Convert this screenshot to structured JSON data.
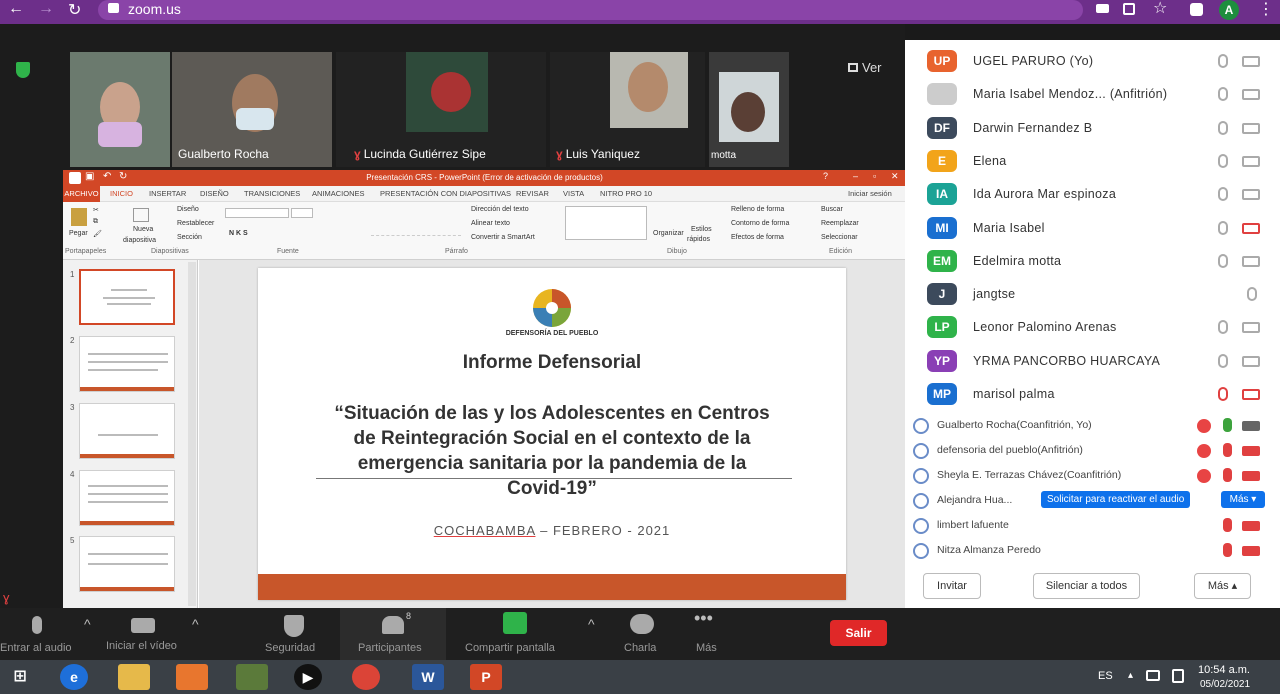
{
  "browser": {
    "url": "zoom.us",
    "avatar": "A",
    "back_icon": "←",
    "forward_icon": "→",
    "reload_icon": "↻"
  },
  "videos": [
    {
      "name": ""
    },
    {
      "name": "Gualberto Rocha"
    },
    {
      "name": "Lucinda Gutiérrez Sipe"
    },
    {
      "name": "Luis Yaniquez"
    },
    {
      "name": "motta"
    }
  ],
  "view_label": "Ver",
  "ppt": {
    "title": "Presentación CRS - PowerPoint (Error de activación de productos)",
    "tabs": [
      "ARCHIVO",
      "INICIO",
      "INSERTAR",
      "DISEÑO",
      "TRANSICIONES",
      "ANIMACIONES",
      "PRESENTACIÓN CON DIAPOSITIVAS",
      "REVISAR",
      "VISTA",
      "NITRO PRO 10"
    ],
    "signin": "Iniciar sesión",
    "groups": [
      "Portapapeles",
      "Diapositivas",
      "Fuente",
      "Párrafo",
      "Dibujo",
      "Edición"
    ],
    "ribbon": {
      "pegar": "Pegar",
      "nueva": "Nueva",
      "diapositiva": "diapositiva",
      "diseno": "Diseño",
      "restablecer": "Restablecer",
      "seccion": "Sección",
      "direccion": "Dirección del texto",
      "alinear": "Alinear texto",
      "convertir": "Convertir a SmartArt",
      "organizar": "Organizar",
      "estilos": "Estilos",
      "rapidos": "rápidos",
      "relleno": "Relleno de forma",
      "contorno": "Contorno de forma",
      "efectos": "Efectos de forma",
      "buscar": "Buscar",
      "reemplazar": "Reemplazar",
      "seleccionar": "Seleccionar"
    },
    "thumb_numbers": [
      "1",
      "2",
      "3",
      "4",
      "5"
    ],
    "slide": {
      "logo_text": "DEFENSORÍA DEL PUEBLO",
      "heading": "Informe Defensorial",
      "quote": "“Situación de las y los Adolescentes en Centros de Reintegración Social en el contexto de la emergencia sanitaria por la pandemia de la Covid-19”",
      "place_city": "COCHABAMBA",
      "place_rest": " – FEBRERO - 2021"
    }
  },
  "participants": [
    {
      "initials": "UP",
      "name": "UGEL PARURO (Yo)",
      "color": "#e8632e",
      "mic": "on",
      "cam": "on"
    },
    {
      "initials": "",
      "name": "Maria Isabel Mendoz... (Anfitrión)",
      "color": "#cccccc",
      "mic": "on",
      "cam": "on"
    },
    {
      "initials": "DF",
      "name": "Darwin Fernandez B",
      "color": "#3c4a5c",
      "mic": "on",
      "cam": "on"
    },
    {
      "initials": "E",
      "name": "Elena",
      "color": "#f2a41a",
      "mic": "on",
      "cam": "on"
    },
    {
      "initials": "IA",
      "name": "Ida Aurora Mar espinoza",
      "color": "#1ba396",
      "mic": "on",
      "cam": "on"
    },
    {
      "initials": "MI",
      "name": "Maria Isabel",
      "color": "#1a6fd0",
      "mic": "on",
      "cam": "off"
    },
    {
      "initials": "EM",
      "name": "Edelmira motta",
      "color": "#2fb34a",
      "mic": "on",
      "cam": "on"
    },
    {
      "initials": "J",
      "name": "jangtse",
      "color": "#3c4a5c",
      "mic": "on",
      "cam": "none"
    },
    {
      "initials": "LP",
      "name": "Leonor Palomino Arenas",
      "color": "#2fb34a",
      "mic": "on",
      "cam": "on"
    },
    {
      "initials": "YP",
      "name": "YRMA PANCORBO HUARCAYA",
      "color": "#8a3fb5",
      "mic": "on",
      "cam": "on"
    },
    {
      "initials": "MP",
      "name": "marisol palma",
      "color": "#1a6fd0",
      "mic": "off",
      "cam": "off"
    }
  ],
  "participants_small": [
    {
      "name": "Gualberto Rocha(Coanfitrión, Yo)",
      "rec": true,
      "mic": "on",
      "cam": "on"
    },
    {
      "name": "defensoria del pueblo(Anfitrión)",
      "rec": true,
      "mic": "off",
      "cam": "off"
    },
    {
      "name": "Sheyla E. Terrazas Chávez(Coanfitrión)",
      "rec": true,
      "mic": "off",
      "cam": "off"
    },
    {
      "name": "Alejandra Hua...",
      "rec": false,
      "mic": "none",
      "cam": "none"
    },
    {
      "name": "limbert lafuente",
      "rec": false,
      "mic": "off",
      "cam": "off"
    },
    {
      "name": "Nitza Almanza Peredo",
      "rec": false,
      "mic": "off",
      "cam": "off"
    }
  ],
  "panel": {
    "solicitar": "Solicitar para reactivar el audio",
    "mas_inline": "Más ▾",
    "invitar": "Invitar",
    "silenciar": "Silenciar a todos",
    "mas": "Más ▴"
  },
  "toolbar": {
    "audio": "Entrar al audio",
    "video": "Iniciar el vídeo",
    "seguridad": "Seguridad",
    "participantes": "Participantes",
    "participant_count": "8",
    "compartir": "Compartir pantalla",
    "charla": "Charla",
    "mas": "Más",
    "salir": "Salir"
  },
  "taskbar": {
    "lang": "ES",
    "time": "10:54 a.m.",
    "date": "05/02/2021",
    "word": "W",
    "ppt": "P"
  }
}
